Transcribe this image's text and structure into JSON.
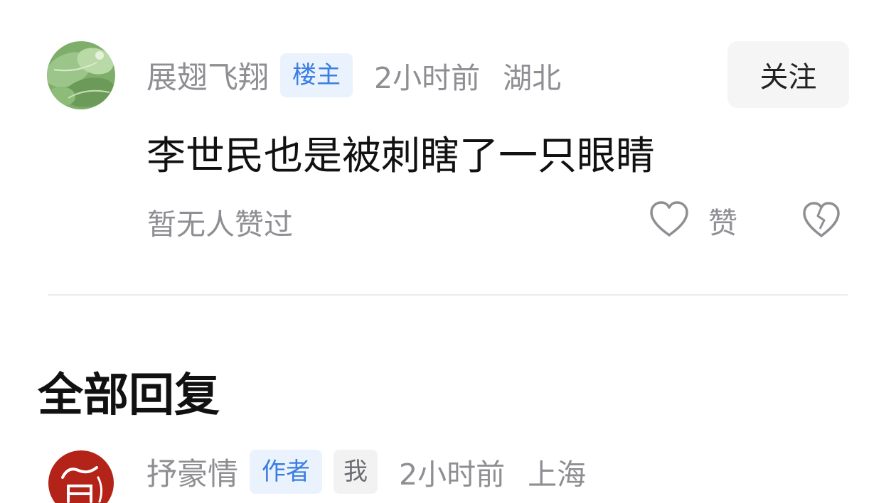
{
  "main_comment": {
    "avatar_icon": "lotus-leaf-avatar",
    "username": "展翅飞翔",
    "badge": "楼主",
    "time": "2小时前",
    "location": "湖北",
    "follow_label": "关注",
    "text": "李世民也是被刺瞎了一只眼睛",
    "likes_status": "暂无人赞过",
    "like_label": "赞",
    "like_icon": "heart-outline-icon",
    "dislike_icon": "broken-heart-icon"
  },
  "replies_section": {
    "title": "全部回复"
  },
  "reply": {
    "avatar_icon": "red-calligraphy-avatar",
    "username": "抒豪情",
    "badge_author": "作者",
    "badge_me": "我",
    "time": "2小时前",
    "location": "上海"
  },
  "colors": {
    "badge_blue_text": "#3a7ee2",
    "badge_blue_bg": "#eaf2fd",
    "meta_gray": "#8e8e93",
    "avatar_red": "#b42318"
  }
}
